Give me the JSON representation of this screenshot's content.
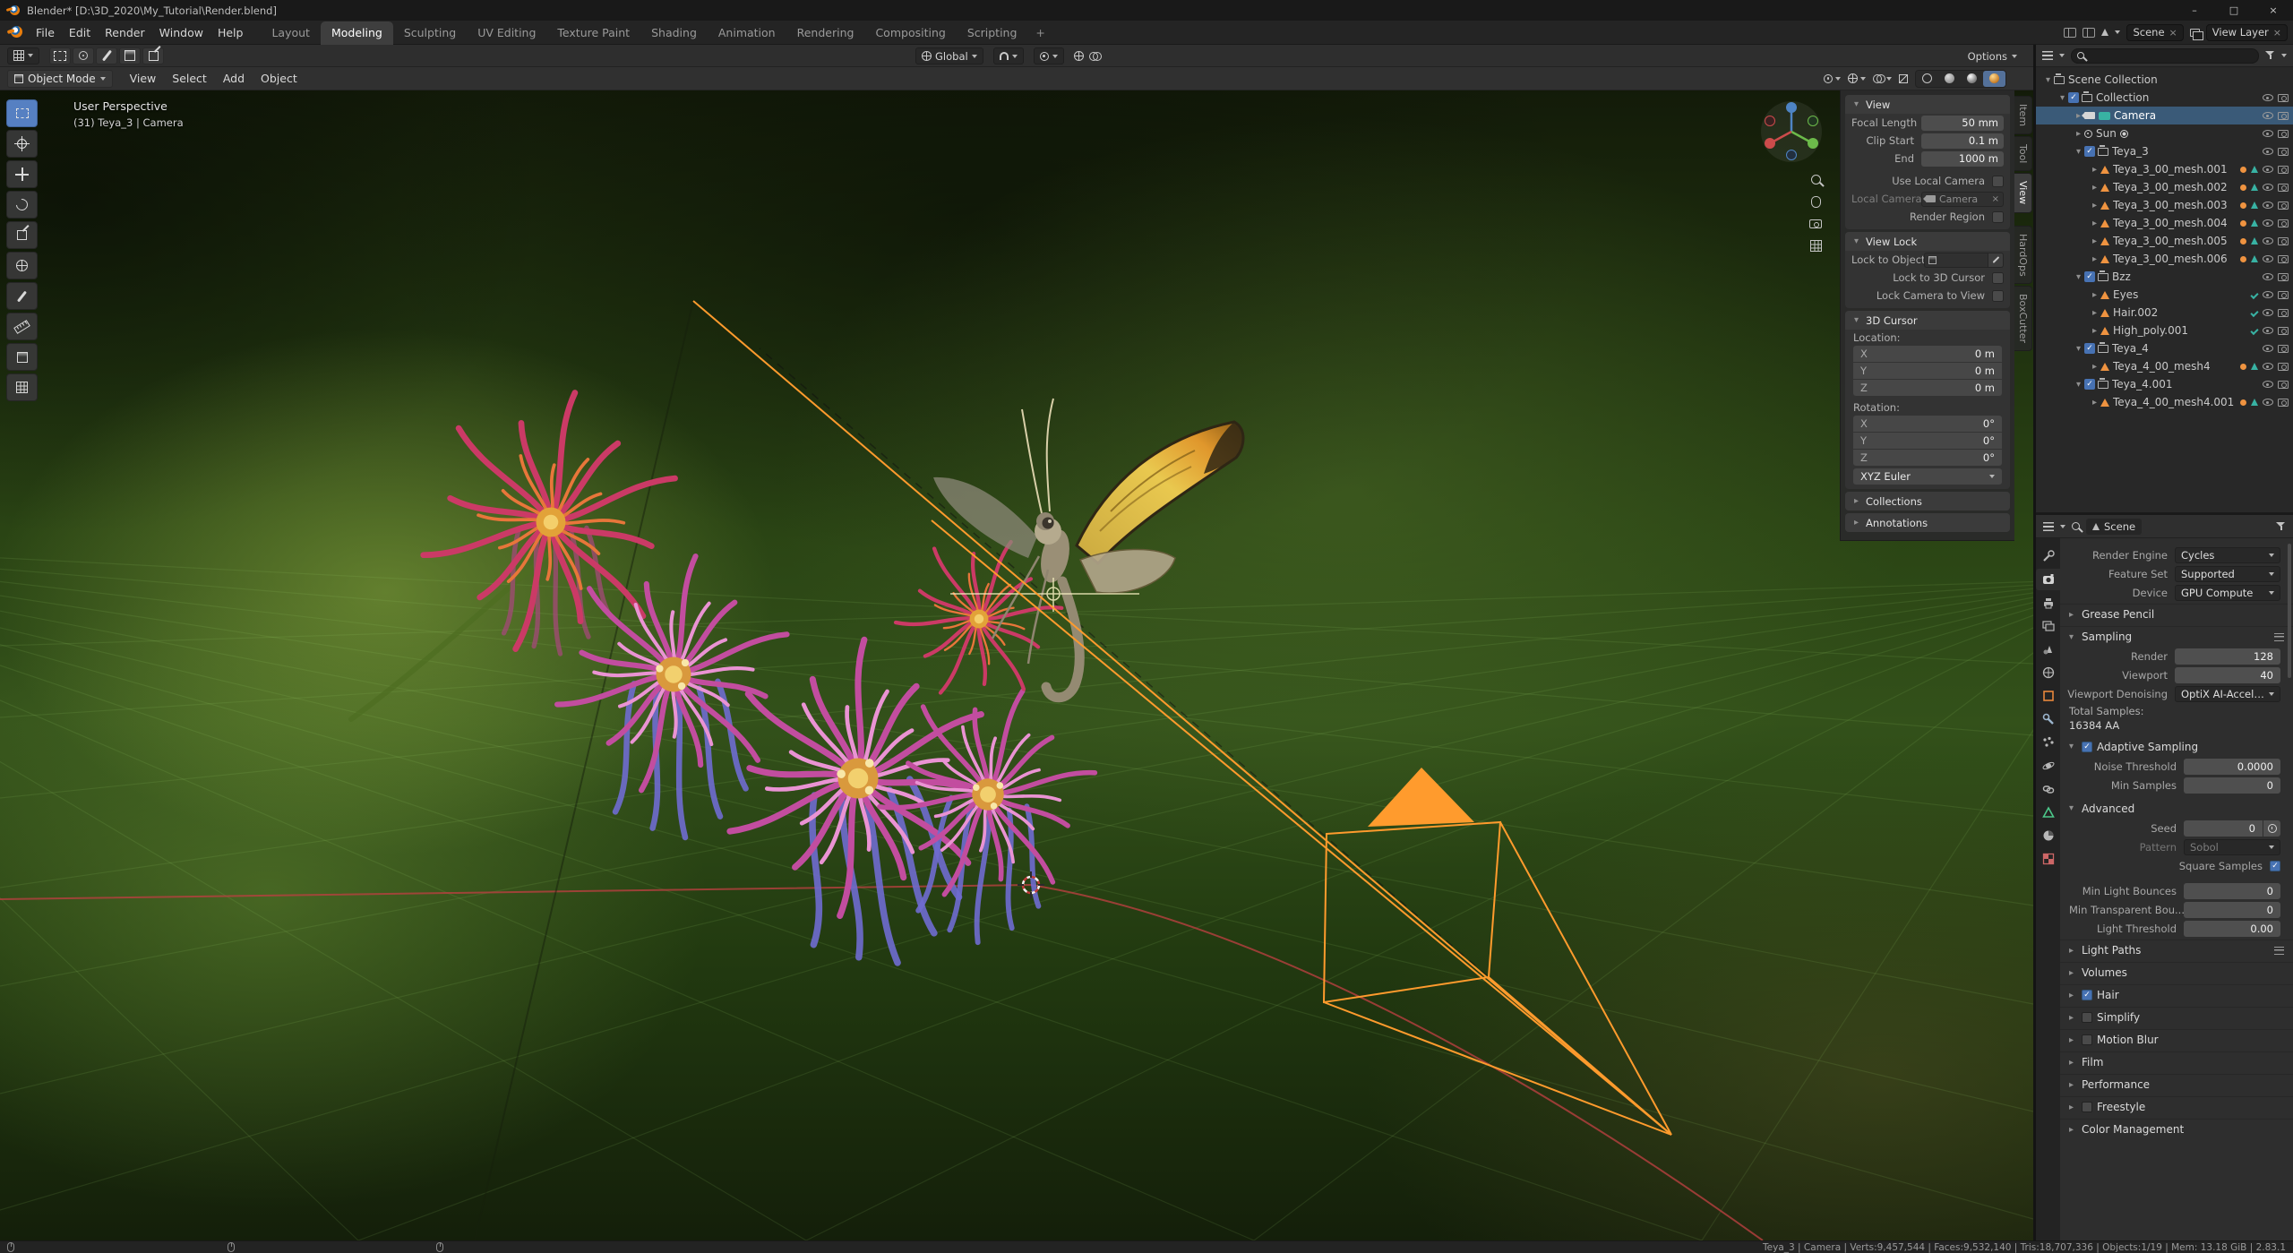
{
  "window": {
    "title": "Blender* [D:\\3D_2020\\My_Tutorial\\Render.blend]",
    "minimize": "–",
    "maximize": "□",
    "close": "×"
  },
  "topbar": {
    "menus": [
      "File",
      "Edit",
      "Render",
      "Window",
      "Help"
    ],
    "workspaces": [
      "Layout",
      "Modeling",
      "Sculpting",
      "UV Editing",
      "Texture Paint",
      "Shading",
      "Animation",
      "Rendering",
      "Compositing",
      "Scripting"
    ],
    "active_workspace": "Modeling",
    "add_workspace": "+",
    "scene": "Scene",
    "view_layer": "View Layer"
  },
  "tool_settings": {
    "orientation": "Global",
    "options": "Options"
  },
  "viewport": {
    "mode": "Object Mode",
    "menus": [
      "View",
      "Select",
      "Add",
      "Object"
    ],
    "overlay": {
      "perspective": "User Perspective",
      "active": "(31) Teya_3 | Camera"
    }
  },
  "npanel": {
    "tabs": [
      "Item",
      "Tool",
      "View",
      "HardOps",
      "BoxCutter"
    ],
    "active_tab": "View",
    "view": {
      "title": "View",
      "rows": [
        {
          "label": "Focal Length",
          "value": "50 mm"
        },
        {
          "label": "Clip Start",
          "value": "0.1 m"
        },
        {
          "label": "End",
          "value": "1000 m"
        }
      ],
      "use_local_camera": "Use Local Camera",
      "local_camera_label": "Local Camera",
      "local_camera": "Camera",
      "render_region": "Render Region"
    },
    "view_lock": {
      "title": "View Lock",
      "lock_to_object": "Lock to Object",
      "lock_3d_cursor": "Lock to 3D Cursor",
      "lock_camera_to_view": "Lock Camera to View"
    },
    "cursor3d": {
      "title": "3D Cursor",
      "location_label": "Location:",
      "rotation_label": "Rotation:",
      "loc": [
        {
          "axis": "X",
          "value": "0 m"
        },
        {
          "axis": "Y",
          "value": "0 m"
        },
        {
          "axis": "Z",
          "value": "0 m"
        }
      ],
      "rot": [
        {
          "axis": "X",
          "value": "0°"
        },
        {
          "axis": "Y",
          "value": "0°"
        },
        {
          "axis": "Z",
          "value": "0°"
        }
      ],
      "rotation_mode": "XYZ Euler"
    },
    "collections": "Collections",
    "annotations": "Annotations"
  },
  "outliner": {
    "rows": [
      {
        "label": "Scene Collection"
      },
      {
        "label": "Collection"
      },
      {
        "label": "Camera"
      },
      {
        "label": "Sun"
      },
      {
        "label": "Teya_3"
      },
      {
        "label": "Teya_3_00_mesh.001"
      },
      {
        "label": "Teya_3_00_mesh.002"
      },
      {
        "label": "Teya_3_00_mesh.003"
      },
      {
        "label": "Teya_3_00_mesh.004"
      },
      {
        "label": "Teya_3_00_mesh.005"
      },
      {
        "label": "Teya_3_00_mesh.006"
      },
      {
        "label": "Bzz"
      },
      {
        "label": "Eyes"
      },
      {
        "label": "Hair.002"
      },
      {
        "label": "High_poly.001"
      },
      {
        "label": "Teya_4"
      },
      {
        "label": "Teya_4_00_mesh4"
      },
      {
        "label": "Teya_4.001"
      },
      {
        "label": "Teya_4_00_mesh4.001"
      }
    ]
  },
  "properties": {
    "breadcrumb": "Scene",
    "render": {
      "engine_label": "Render Engine",
      "engine": "Cycles",
      "feature_label": "Feature Set",
      "feature": "Supported",
      "device_label": "Device",
      "device": "GPU Compute",
      "grease_pencil": "Grease Pencil",
      "sampling_title": "Sampling",
      "render_label": "Render",
      "render_samples": "128",
      "viewport_label": "Viewport",
      "viewport_samples": "40",
      "denoising_label": "Viewport Denoising",
      "denoising": "OptiX AI-Accelerat...",
      "total_samples_label": "Total Samples:",
      "total_samples": "16384 AA",
      "adaptive_sampling": "Adaptive Sampling",
      "noise_threshold_label": "Noise Threshold",
      "noise_threshold": "0.0000",
      "min_samples_label": "Min Samples",
      "min_samples": "0",
      "advanced": "Advanced",
      "seed_label": "Seed",
      "seed": "0",
      "pattern_label": "Pattern",
      "pattern": "Sobol",
      "square_samples": "Square Samples",
      "min_light_label": "Min Light Bounces",
      "min_light": "0",
      "min_transparent_label": "Min Transparent Bou...",
      "min_transparent": "0",
      "light_threshold_label": "Light Threshold",
      "light_threshold": "0.00",
      "sections": [
        "Light Paths",
        "Volumes",
        "Hair",
        "Simplify",
        "Motion Blur",
        "Film",
        "Performance",
        "Freestyle",
        "Color Management"
      ]
    }
  },
  "statusbar": {
    "stats": "Teya_3 | Camera | Verts:9,457,544 | Faces:9,532,140 | Tris:18,707,336 | Objects:1/19 | Mem: 13.18 GiB | 2.83.1"
  }
}
